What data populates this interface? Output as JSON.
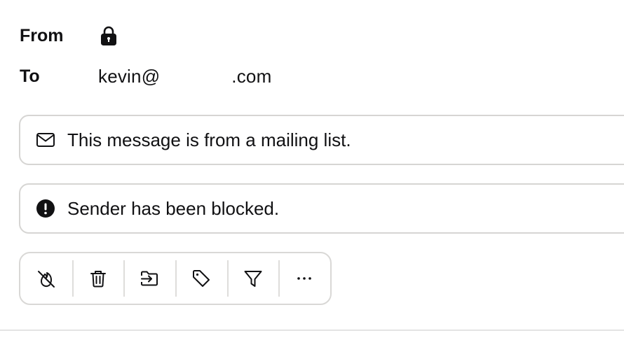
{
  "header": {
    "from_label": "From",
    "from_icon": "lock-icon",
    "to_label": "To",
    "to_value_prefix": "kevin@",
    "to_value_suffix": ".com"
  },
  "banners": [
    {
      "icon": "mail-icon",
      "text": "This message is from a mailing list."
    },
    {
      "icon": "alert-circle-icon",
      "text": "Sender has been blocked."
    }
  ],
  "toolbar": {
    "actions": [
      {
        "name": "unburn",
        "icon": "flame-off-icon"
      },
      {
        "name": "delete",
        "icon": "trash-icon"
      },
      {
        "name": "move-to-folder",
        "icon": "folder-move-icon"
      },
      {
        "name": "label",
        "icon": "tag-icon"
      },
      {
        "name": "filter",
        "icon": "filter-icon"
      },
      {
        "name": "more",
        "icon": "more-horizontal-icon"
      }
    ]
  },
  "colors": {
    "text": "#111113",
    "border": "#d6d5d3",
    "divider": "#e4e4e4"
  }
}
